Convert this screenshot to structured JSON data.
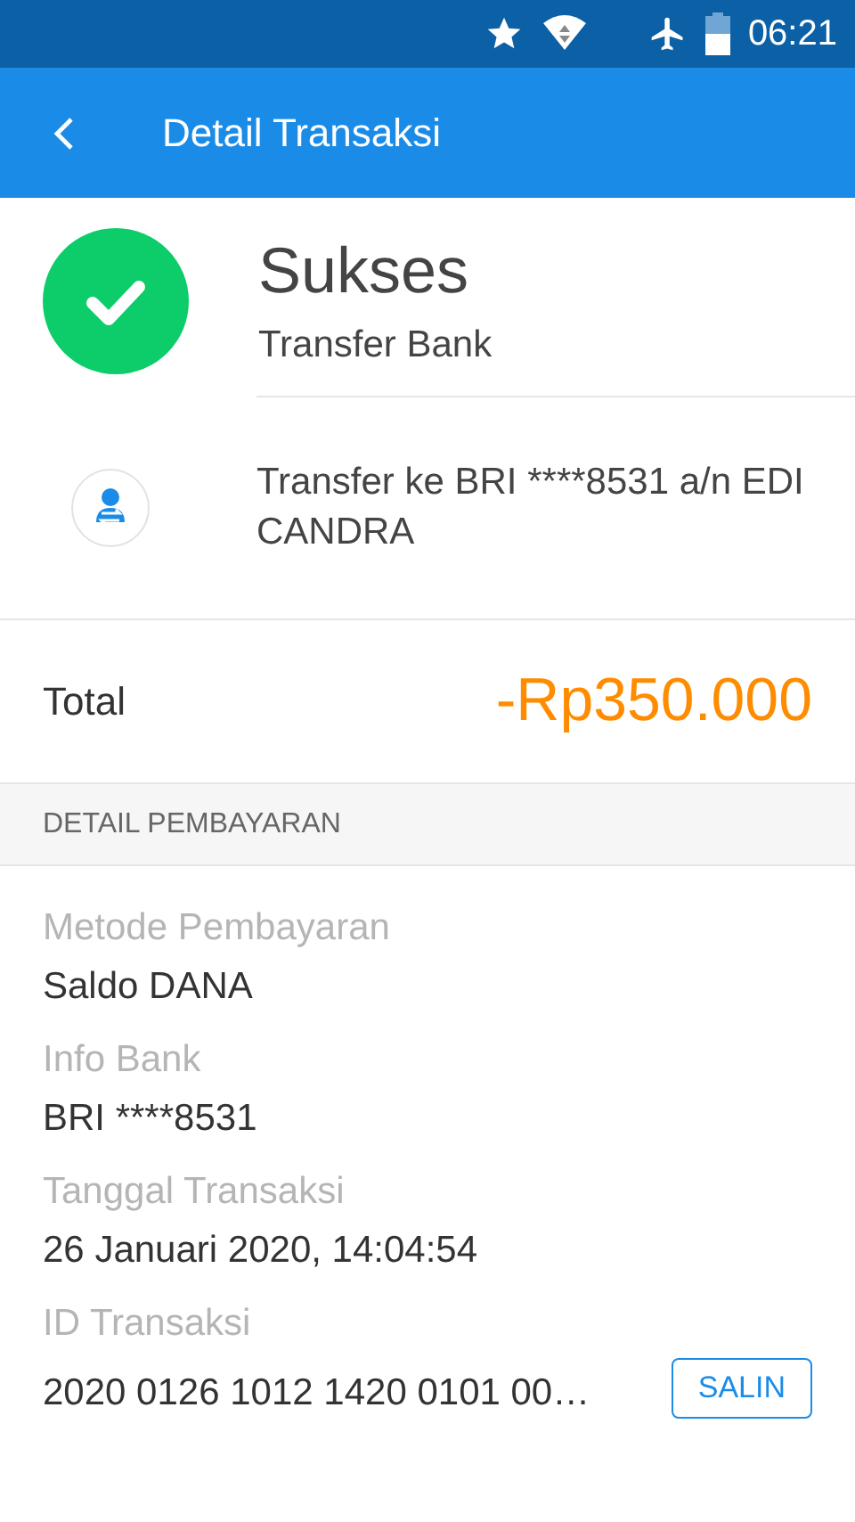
{
  "status_bar": {
    "time": "06:21"
  },
  "app_bar": {
    "title": "Detail Transaksi"
  },
  "summary": {
    "status": "Sukses",
    "type": "Transfer Bank",
    "description": "Transfer ke BRI ****8531 a/n EDI CANDRA"
  },
  "total": {
    "label": "Total",
    "amount": "-Rp350.000"
  },
  "section": {
    "title": "DETAIL PEMBAYARAN"
  },
  "details": [
    {
      "label": "Metode Pembayaran",
      "value": "Saldo DANA"
    },
    {
      "label": "Info Bank",
      "value": "BRI ****8531"
    },
    {
      "label": "Tanggal Transaksi",
      "value": "26 Januari 2020, 14:04:54"
    },
    {
      "label": "ID Transaksi",
      "value": "2020 0126 1012 1420 0101 00…",
      "action": "SALIN"
    }
  ]
}
